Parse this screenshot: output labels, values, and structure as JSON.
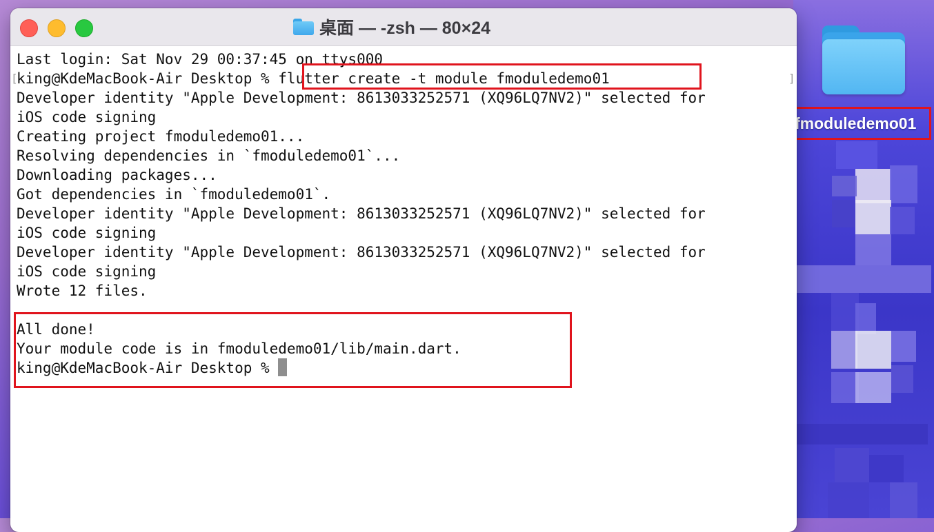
{
  "window": {
    "title": "桌面 — -zsh — 80×24"
  },
  "terminal": {
    "lines": [
      "Last login: Sat Nov 29 00:37:45 on ttys000",
      "king@KdeMacBook-Air Desktop % flutter create -t module fmoduledemo01",
      "Developer identity \"Apple Development: 8613033252571 (XQ96LQ7NV2)\" selected for",
      "iOS code signing",
      "Creating project fmoduledemo01...",
      "Resolving dependencies in `fmoduledemo01`...",
      "Downloading packages...",
      "Got dependencies in `fmoduledemo01`.",
      "Developer identity \"Apple Development: 8613033252571 (XQ96LQ7NV2)\" selected for",
      "iOS code signing",
      "Developer identity \"Apple Development: 8613033252571 (XQ96LQ7NV2)\" selected for",
      "iOS code signing",
      "Wrote 12 files.",
      "",
      "All done!",
      "Your module code is in fmoduledemo01/lib/main.dart.",
      "king@KdeMacBook-Air Desktop % "
    ]
  },
  "desktop": {
    "folder_label": "fmoduledemo01"
  },
  "colors": {
    "highlight": "#e0141d",
    "close": "#ff5f57",
    "minimize": "#febc2e",
    "maximize": "#28c840"
  }
}
